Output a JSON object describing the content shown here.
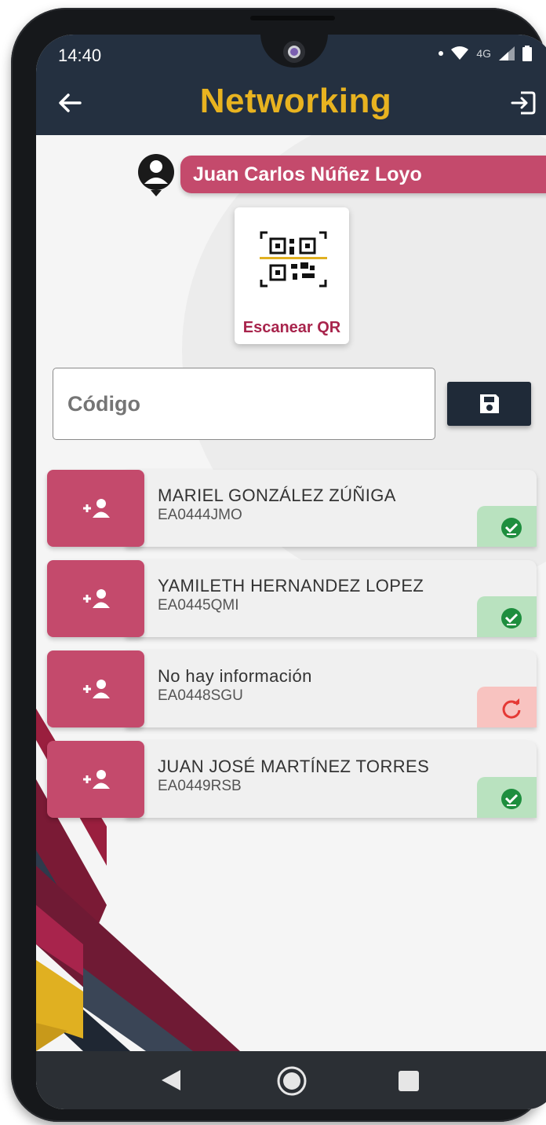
{
  "status_bar": {
    "time": "14:40",
    "network_label": "4G"
  },
  "header": {
    "title": "Networking",
    "title_color": "#e8b320",
    "background": "#243040"
  },
  "user": {
    "name": "Juan Carlos Núñez Loyo"
  },
  "scanner": {
    "label": "Escanear QR"
  },
  "code_input": {
    "placeholder": "Código",
    "value": ""
  },
  "contacts": [
    {
      "name": "MARIEL GONZÁLEZ ZÚÑIGA",
      "code": "EA0444JMO",
      "status": "ok",
      "status_icon": "check-circle-icon"
    },
    {
      "name": "YAMILETH HERNANDEZ LOPEZ",
      "code": "EA0445QMI",
      "status": "ok",
      "status_icon": "check-circle-icon"
    },
    {
      "name": "No hay información",
      "code": "EA0448SGU",
      "status": "retry",
      "status_icon": "refresh-icon"
    },
    {
      "name": "JUAN JOSÉ MARTÍNEZ TORRES",
      "code": "EA0449RSB",
      "status": "ok",
      "status_icon": "check-circle-icon"
    }
  ],
  "colors": {
    "accent": "#c44a6c",
    "dark": "#243040",
    "ok": "#b9e2bf",
    "error": "#f8c3c0"
  }
}
